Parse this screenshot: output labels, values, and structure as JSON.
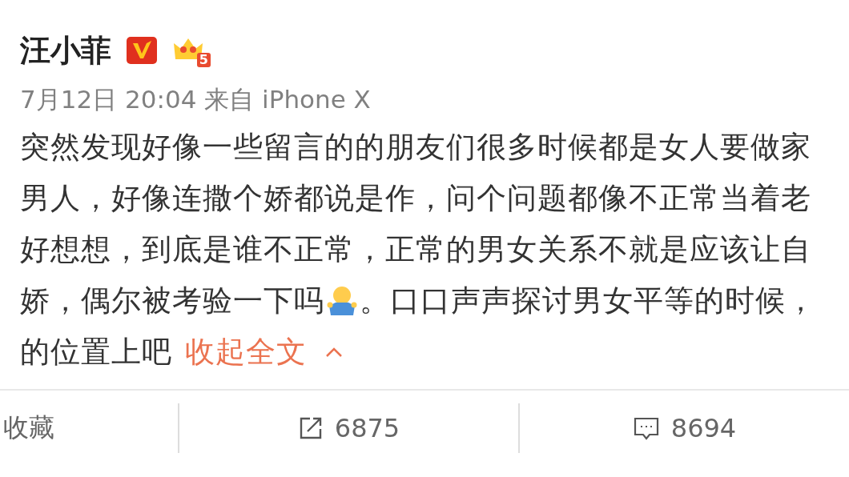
{
  "post": {
    "author": "汪小菲",
    "verified": true,
    "member_level": "5",
    "meta": "7月12日 20:04 来自 iPhone X",
    "lines": [
      {
        "segments": [
          {
            "kind": "text",
            "text": "突然发现好像一些留言的的朋友们很多时候都是女人要做家"
          }
        ]
      },
      {
        "segments": [
          {
            "kind": "text",
            "text": "男人，好像连撒个娇都说是作，问个问题都像不正常当着老"
          }
        ]
      },
      {
        "segments": [
          {
            "kind": "text",
            "text": "好想想，到底是谁不正常，正常的男女关系不就是应该让自"
          }
        ]
      },
      {
        "segments": [
          {
            "kind": "text",
            "text": "娇，偶尔被考验一下吗"
          },
          {
            "kind": "emoji"
          },
          {
            "kind": "text",
            "text": "。口口声声探讨男女平等的时候，"
          }
        ]
      },
      {
        "segments": [
          {
            "kind": "text",
            "text": "的位置上吧"
          },
          {
            "kind": "link",
            "text": "收起全文"
          },
          {
            "kind": "caret"
          }
        ]
      }
    ]
  },
  "actions": [
    {
      "kind": "favorite",
      "label": "收藏"
    },
    {
      "kind": "share",
      "label": "6875"
    },
    {
      "kind": "comment",
      "label": "8694"
    }
  ]
}
